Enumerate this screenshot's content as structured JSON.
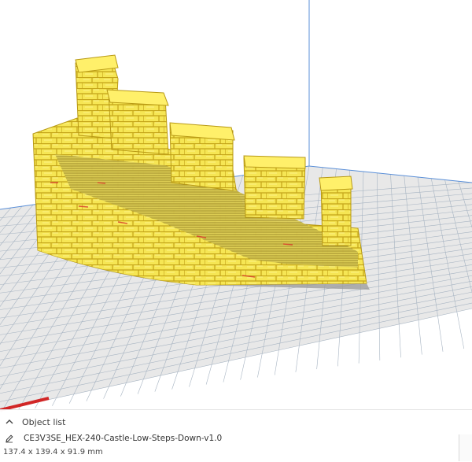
{
  "object_list": {
    "header_label": "Object list",
    "object_name": "CE3V3SE_HEX-240-Castle-Low-Steps-Down-v1.0",
    "dimensions": "137.4 x 139.4 x 91.9 mm"
  },
  "icons": {
    "collapse": "chevron-up-icon",
    "edit": "pencil-icon"
  },
  "colors": {
    "model": "#f3e24c",
    "model_shadow": "#c9a816",
    "plate": "#e6e6e6",
    "grid": "#9aaaba",
    "grid_border": "#4f88d6",
    "x_axis": "#d12626"
  }
}
